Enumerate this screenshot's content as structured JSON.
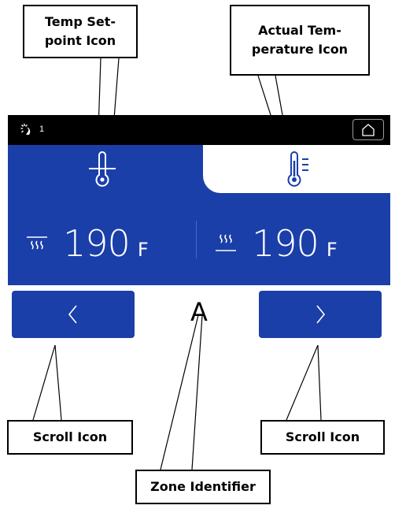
{
  "callouts": {
    "temp_setpoint_line1": "Temp Set-",
    "temp_setpoint_line2": "point Icon",
    "actual_temp_line1": "Actual Tem-",
    "actual_temp_line2": "perature Icon",
    "scroll_left": "Scroll Icon",
    "scroll_right": "Scroll Icon",
    "zone_identifier": "Zone Identifier"
  },
  "topbar": {
    "light_level": "1",
    "icons": [
      "light-icon",
      "home-icon"
    ]
  },
  "tabs": [
    {
      "icon": "thermometer-setpoint-icon",
      "selected": true
    },
    {
      "icon": "thermometer-actual-icon",
      "selected": false
    }
  ],
  "readings": {
    "setpoint": {
      "value": "190",
      "unit": "F",
      "icon": "heat-setpoint-icon"
    },
    "actual": {
      "value": "190",
      "unit": "F",
      "icon": "heat-actual-icon"
    }
  },
  "zone": {
    "label": "A"
  },
  "colors": {
    "panel": "#1a3fa9",
    "topbar": "#000000",
    "accent_icon": "#1a3fa9"
  }
}
